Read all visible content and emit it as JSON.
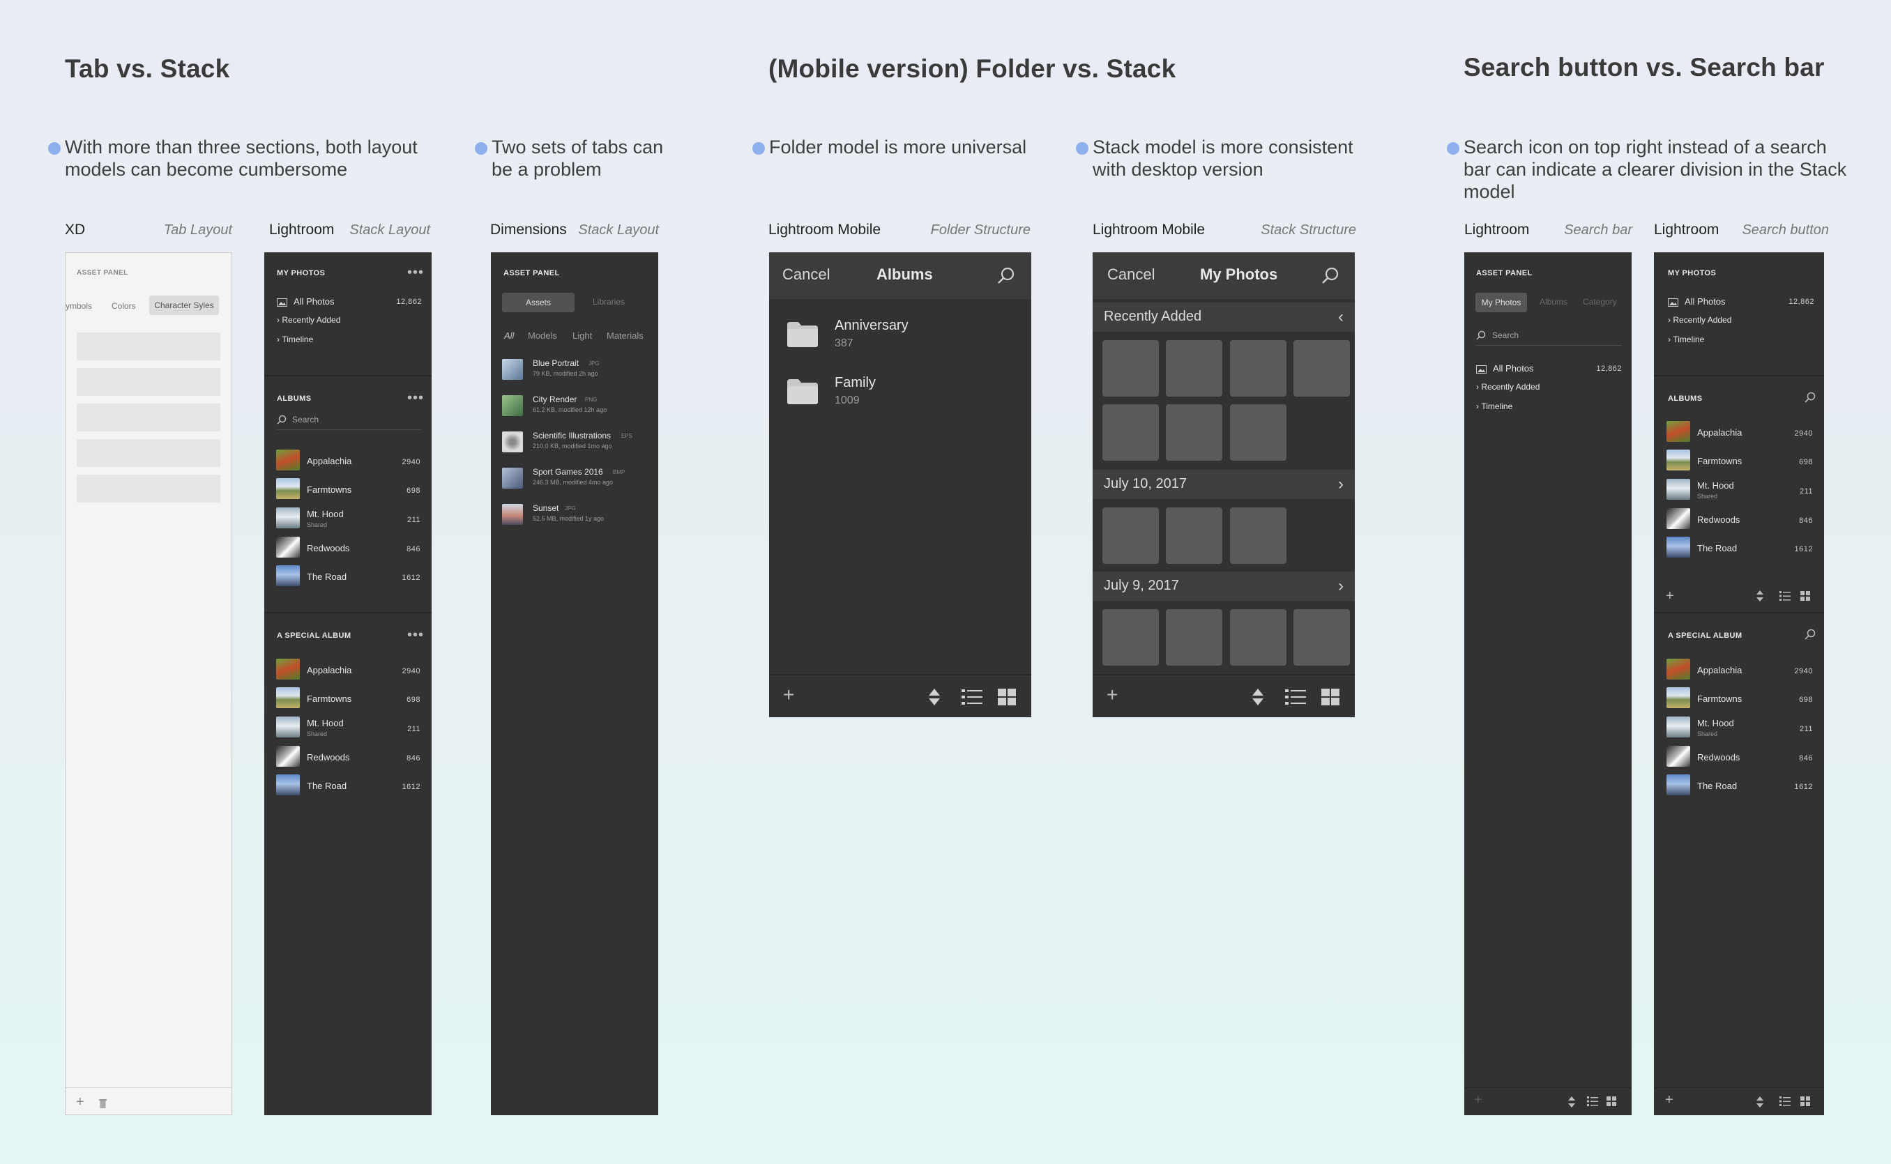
{
  "sections": {
    "tab_vs_stack": {
      "title": "Tab vs. Stack",
      "note1": "With more than three sections, both layout models can become cumbersome",
      "note2": "Two sets of tabs can be a problem"
    },
    "folder_vs_stack": {
      "title": "(Mobile version) Folder vs. Stack",
      "note1": "Folder model is more universal",
      "note2": "Stack model is more consistent with desktop version"
    },
    "search": {
      "title": "Search button vs. Search bar",
      "note1": "Search icon on top right instead of a search bar can indicate a clearer division in the Stack model"
    }
  },
  "labels": {
    "xd": {
      "app": "XD",
      "layout": "Tab Layout"
    },
    "lr_stack": {
      "app": "Lightroom",
      "layout": "Stack Layout"
    },
    "dim": {
      "app": "Dimensions",
      "layout": "Stack Layout"
    },
    "lrm_folder": {
      "app": "Lightroom Mobile",
      "layout": "Folder Structure"
    },
    "lrm_stack": {
      "app": "Lightroom Mobile",
      "layout": "Stack Structure"
    },
    "lr_bar": {
      "app": "Lightroom",
      "layout": "Search bar"
    },
    "lr_button": {
      "app": "Lightroom",
      "layout": "Search button"
    }
  },
  "xd_panel": {
    "header": "ASSET PANEL",
    "tabs": [
      "ymbols",
      "Colors",
      "Character Syles"
    ]
  },
  "lr_panel": {
    "my_photos": "MY PHOTOS",
    "all_photos": "All Photos",
    "all_count": "12,862",
    "recently_added": "Recently Added",
    "timeline": "Timeline",
    "albums": "ALBUMS",
    "search_placeholder": "Search",
    "special_album": "A SPECIAL ALBUM",
    "items": [
      {
        "name": "Appalachia",
        "count": "2940",
        "sub": ""
      },
      {
        "name": "Farmtowns",
        "count": "698",
        "sub": ""
      },
      {
        "name": "Mt. Hood",
        "count": "211",
        "sub": "Shared"
      },
      {
        "name": "Redwoods",
        "count": "846",
        "sub": ""
      },
      {
        "name": "The Road",
        "count": "1612",
        "sub": ""
      }
    ]
  },
  "dim_panel": {
    "header": "ASSET PANEL",
    "tab_assets": "Assets",
    "tab_libraries": "Libraries",
    "filters": [
      "All",
      "Models",
      "Light",
      "Materials"
    ],
    "assets": [
      {
        "name": "Blue Portrait",
        "ext": "JPG",
        "meta": "79 KB, modified 2h ago"
      },
      {
        "name": "City Render",
        "ext": "PNG",
        "meta": "61.2 KB, modified 12h ago"
      },
      {
        "name": "Scientific Illustrations",
        "ext": "EPS",
        "meta": "210.0 KB, modified 1mo ago"
      },
      {
        "name": "Sport Games 2016",
        "ext": "BMP",
        "meta": "246.3 MB, modified 4mo ago"
      },
      {
        "name": "Sunset",
        "ext": "JPG",
        "meta": "52.5 MB, modified 1y ago"
      }
    ]
  },
  "mobile_folder": {
    "cancel": "Cancel",
    "title": "Albums",
    "folders": [
      {
        "name": "Anniversary",
        "count": "387"
      },
      {
        "name": "Family",
        "count": "1009"
      }
    ]
  },
  "mobile_stack": {
    "cancel": "Cancel",
    "title": "My Photos",
    "sections": [
      "Recently Added",
      "July 10, 2017",
      "July 9, 2017"
    ]
  },
  "lr_bar_panel": {
    "header": "ASSET PANEL",
    "tabs": [
      "My Photos",
      "Albums",
      "Category"
    ],
    "search_placeholder": "Search",
    "all_photos": "All Photos",
    "all_count": "12,862",
    "recently_added": "Recently Added",
    "timeline": "Timeline"
  },
  "colors": {
    "panel_dark": "#323232",
    "bullet": "#8fb0ee",
    "tile": "#5a5a5a"
  }
}
